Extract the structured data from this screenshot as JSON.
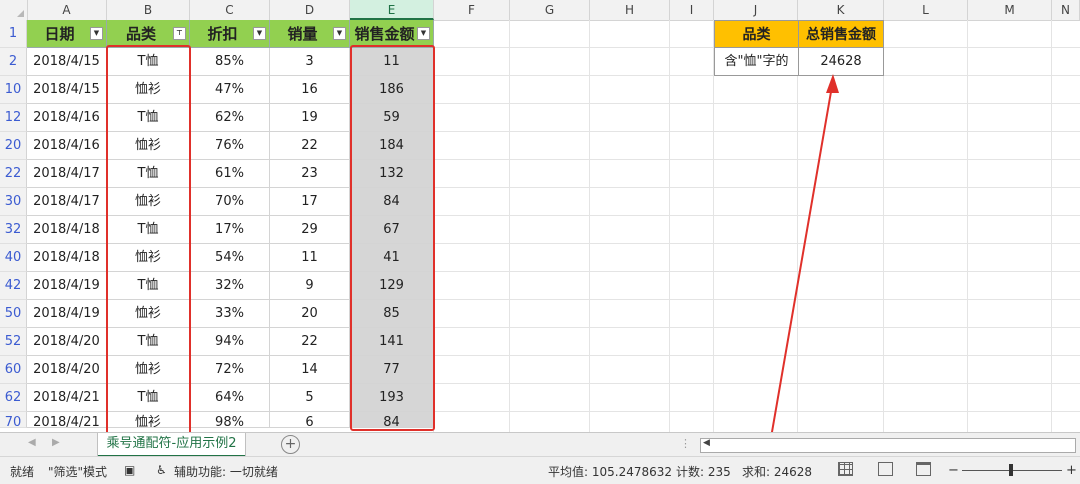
{
  "columns": [
    "A",
    "B",
    "C",
    "D",
    "E",
    "F",
    "G",
    "H",
    "I",
    "J",
    "K",
    "L",
    "M",
    "N"
  ],
  "table": {
    "headers": [
      "日期",
      "品类",
      "折扣",
      "销量",
      "销售金额"
    ],
    "rows": [
      {
        "row": "2",
        "date": "2018/4/15",
        "cat": "T恤",
        "disc": "85%",
        "qty": "3",
        "amt": "11"
      },
      {
        "row": "10",
        "date": "2018/4/15",
        "cat": "恤衫",
        "disc": "47%",
        "qty": "16",
        "amt": "186"
      },
      {
        "row": "12",
        "date": "2018/4/16",
        "cat": "T恤",
        "disc": "62%",
        "qty": "19",
        "amt": "59"
      },
      {
        "row": "20",
        "date": "2018/4/16",
        "cat": "恤衫",
        "disc": "76%",
        "qty": "22",
        "amt": "184"
      },
      {
        "row": "22",
        "date": "2018/4/17",
        "cat": "T恤",
        "disc": "61%",
        "qty": "23",
        "amt": "132"
      },
      {
        "row": "30",
        "date": "2018/4/17",
        "cat": "恤衫",
        "disc": "70%",
        "qty": "17",
        "amt": "84"
      },
      {
        "row": "32",
        "date": "2018/4/18",
        "cat": "T恤",
        "disc": "17%",
        "qty": "29",
        "amt": "67"
      },
      {
        "row": "40",
        "date": "2018/4/18",
        "cat": "恤衫",
        "disc": "54%",
        "qty": "11",
        "amt": "41"
      },
      {
        "row": "42",
        "date": "2018/4/19",
        "cat": "T恤",
        "disc": "32%",
        "qty": "9",
        "amt": "129"
      },
      {
        "row": "50",
        "date": "2018/4/19",
        "cat": "恤衫",
        "disc": "33%",
        "qty": "20",
        "amt": "85"
      },
      {
        "row": "52",
        "date": "2018/4/20",
        "cat": "T恤",
        "disc": "94%",
        "qty": "22",
        "amt": "141"
      },
      {
        "row": "60",
        "date": "2018/4/20",
        "cat": "恤衫",
        "disc": "72%",
        "qty": "14",
        "amt": "77"
      },
      {
        "row": "62",
        "date": "2018/4/21",
        "cat": "T恤",
        "disc": "64%",
        "qty": "5",
        "amt": "193"
      },
      {
        "row": "70",
        "date": "2018/4/21",
        "cat": "恤衫",
        "disc": "98%",
        "qty": "6",
        "amt": "84"
      }
    ]
  },
  "summary": {
    "header_cat": "品类",
    "header_total": "总销售金额",
    "cat_value": "含\"恤\"字的",
    "total_value": "24628"
  },
  "sheet_tab": "乘号通配符-应用示例2",
  "status": {
    "ready": "就绪",
    "filter_mode": "\"筛选\"模式",
    "accessibility": "辅助功能: 一切就绪",
    "average": "平均值: 105.2478632",
    "count": "计数: 235",
    "sum": "求和: 24628"
  },
  "colors": {
    "header_green": "#92d050",
    "summary_orange": "#ffc000",
    "highlight_red": "#e0302a",
    "excel_green": "#217346"
  }
}
